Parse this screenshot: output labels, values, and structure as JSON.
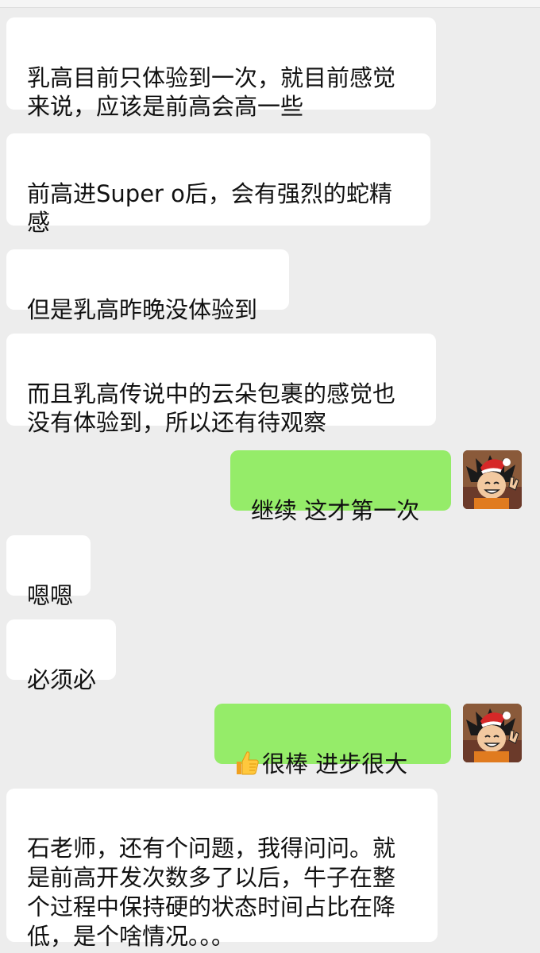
{
  "messages": [
    {
      "text": "乳高目前只体验到一次，就目前感觉\n来说，应该是前高会高一些"
    },
    {
      "text": "前高进Super o后，会有强烈的蛇精\n感"
    },
    {
      "text": "但是乳高昨晚没体验到"
    },
    {
      "text": "而且乳高传说中的云朵包裹的感觉也\n没有体验到，所以还有待观察"
    },
    {
      "text": "继续 这才第一次"
    },
    {
      "text": "嗯嗯"
    },
    {
      "text": "必须必"
    },
    {
      "emoji": "thumbs-up",
      "text": "很棒  进步很大"
    },
    {
      "text": "石老师，还有个问题，我得问问。就\n是前高开发次数多了以后，牛子在整\n个过程中保持硬的状态时间占比在降\n低，是个啥情况。。。"
    }
  ],
  "colors": {
    "background": "#ededed",
    "incoming": "#ffffff",
    "outgoing": "#95ec69"
  }
}
